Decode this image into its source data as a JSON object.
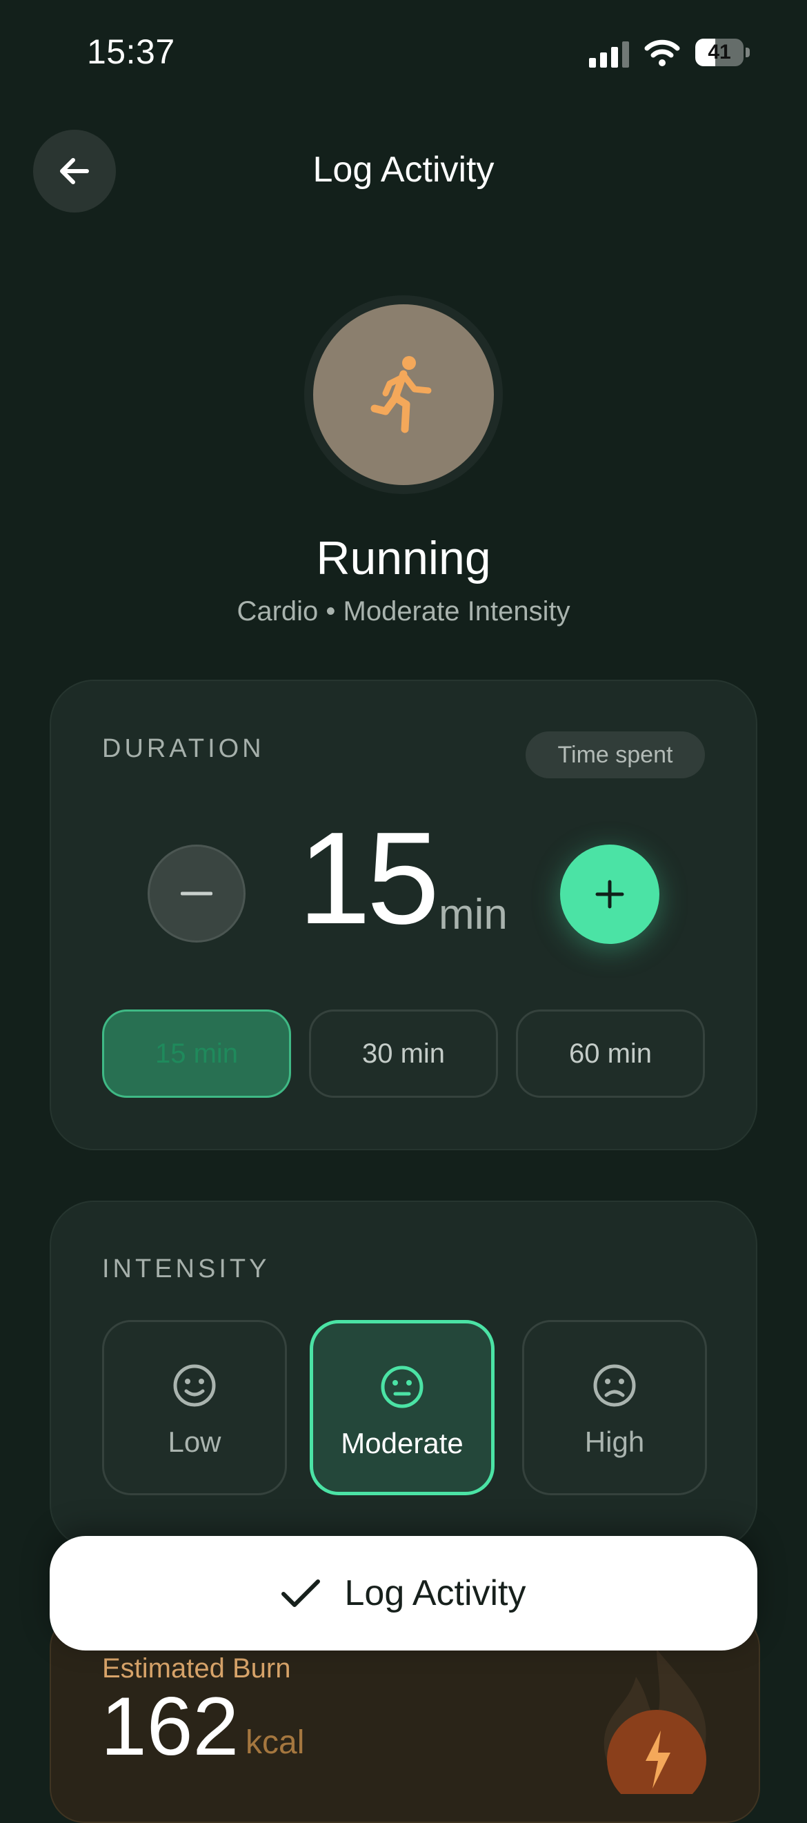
{
  "status_bar": {
    "time": "15:37",
    "battery": "41",
    "battery_level": 0.41
  },
  "header": {
    "title": "Log Activity",
    "back_icon": "arrow-left-icon"
  },
  "activity": {
    "name": "Running",
    "subtitle": "Cardio • Moderate Intensity",
    "icon": "running-person-icon",
    "icon_bg": "#8b7f6e",
    "icon_color": "#f4a85a"
  },
  "duration": {
    "label": "DURATION",
    "pill": "Time spent",
    "value": "15",
    "unit": "min",
    "minus": "−",
    "plus": "+",
    "presets": [
      "15 min",
      "30 min",
      "60 min"
    ],
    "selected_preset": "15 min"
  },
  "intensity": {
    "label": "INTENSITY",
    "options": [
      "Low",
      "Moderate",
      "High"
    ],
    "selected": "Moderate"
  },
  "burn": {
    "label": "Estimated Burn",
    "value": "162",
    "unit": "kcal",
    "icon": "lightning-icon"
  },
  "action": {
    "label": "Log Activity",
    "icon": "checkmark-icon"
  },
  "colors": {
    "accent": "#4be3a5",
    "background": "#13201b",
    "card": "#1d2b26"
  }
}
